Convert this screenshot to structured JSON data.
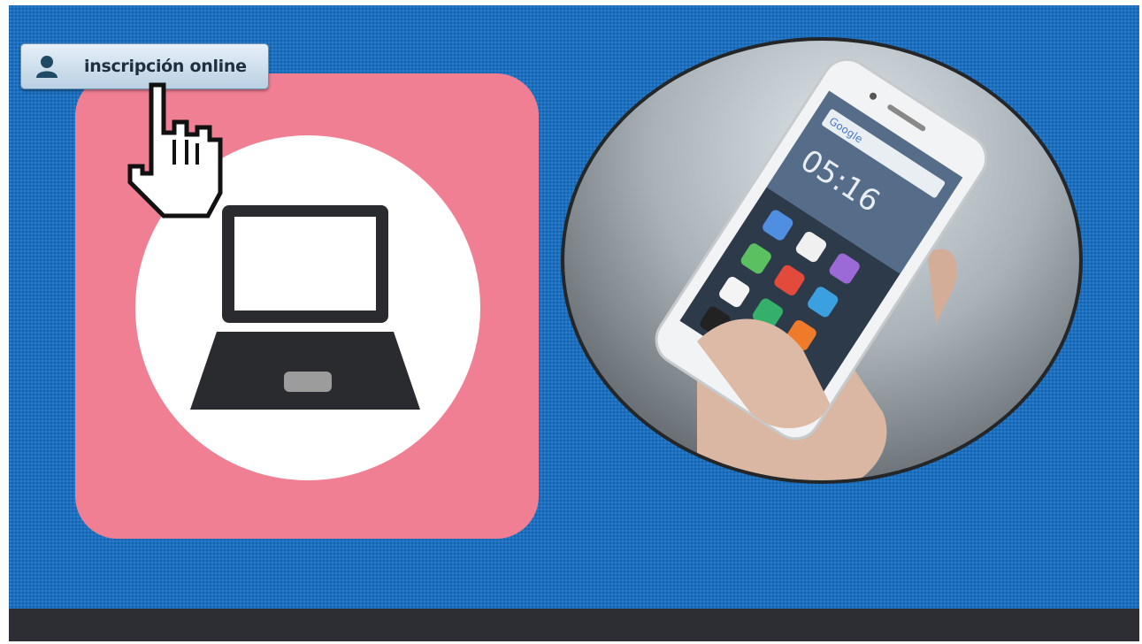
{
  "register_button": {
    "label": "inscripción online",
    "icon": "user-icon"
  },
  "illustrations": {
    "laptop_icon": "laptop-icon",
    "pointer_icon": "hand-pointer-icon",
    "photo": "smartphone-photo"
  },
  "phone_screen": {
    "time": "05:16",
    "search_label": "Google"
  },
  "colors": {
    "background": "#1a6fc0",
    "tile": "#f07f93",
    "bottom_bar": "#2c2e33"
  }
}
